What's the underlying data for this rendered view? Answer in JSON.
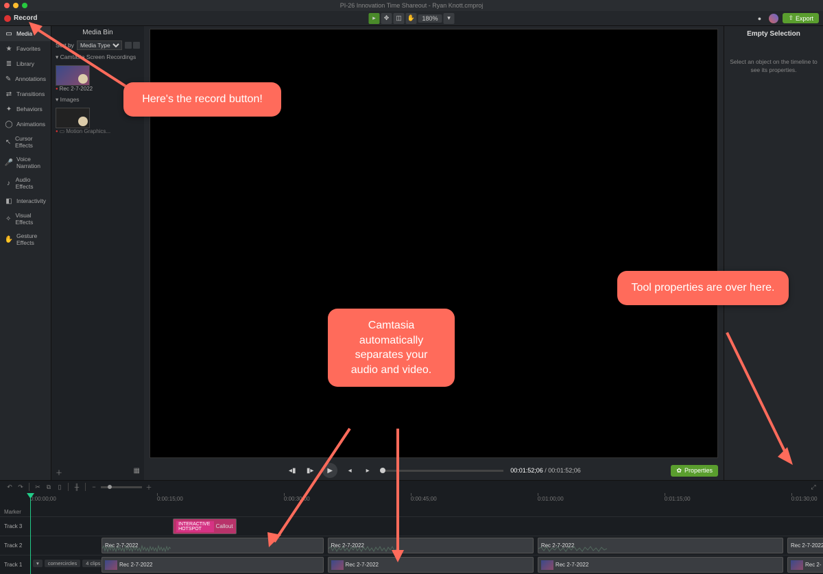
{
  "titlebar": {
    "title": "PI-26 Innovation Time Shareout - Ryan Knott.cmproj"
  },
  "toolbar": {
    "record_label": "Record",
    "zoom": "180%",
    "export_label": "Export"
  },
  "tool_tabs": [
    {
      "icon": "▭",
      "label": "Media"
    },
    {
      "icon": "★",
      "label": "Favorites"
    },
    {
      "icon": "≣",
      "label": "Library"
    },
    {
      "icon": "✎",
      "label": "Annotations"
    },
    {
      "icon": "⇄",
      "label": "Transitions"
    },
    {
      "icon": "✦",
      "label": "Behaviors"
    },
    {
      "icon": "◯",
      "label": "Animations"
    },
    {
      "icon": "↖",
      "label": "Cursor Effects"
    },
    {
      "icon": "🎤",
      "label": "Voice Narration"
    },
    {
      "icon": "♪",
      "label": "Audio Effects"
    },
    {
      "icon": "◧",
      "label": "Interactivity"
    },
    {
      "icon": "✧",
      "label": "Visual Effects"
    },
    {
      "icon": "✋",
      "label": "Gesture Effects"
    }
  ],
  "media_bin": {
    "title": "Media Bin",
    "sort_label": "Sort by",
    "sort_value": "Media Type",
    "group1": "Camtasia Screen Recordings",
    "clip1": "Rec 2-7-2022",
    "group2": "Images",
    "clip2": "Motion Graphics..."
  },
  "canvas": {
    "timecode_current": "00:01:52;06",
    "timecode_total": "00:01:52;06",
    "properties_label": "Properties"
  },
  "right_panel": {
    "title": "Empty Selection",
    "message": "Select an object on the timeline to see its properties."
  },
  "timeline": {
    "marker_label": "Marker",
    "tracks": [
      "Track 3",
      "Track 2",
      "Track 1"
    ],
    "ruler": [
      "0:00:00;00",
      "0:00:15;00",
      "0:00:30;00",
      "0:00:45;00",
      "0:01:00;00",
      "0:01:15;00",
      "0:01:30;00"
    ],
    "callout_clip": "Callout",
    "callout_tag": "INTERACTIVE HOTSPOT",
    "rec_clip": "Rec 2-7-2022",
    "t1_name": "cornercircles",
    "t1_count": "4 clips"
  },
  "annotations": {
    "a1": "Here's the record button!",
    "a2": "Camtasia automatically separates your audio and video.",
    "a3": "Tool properties are over here."
  }
}
